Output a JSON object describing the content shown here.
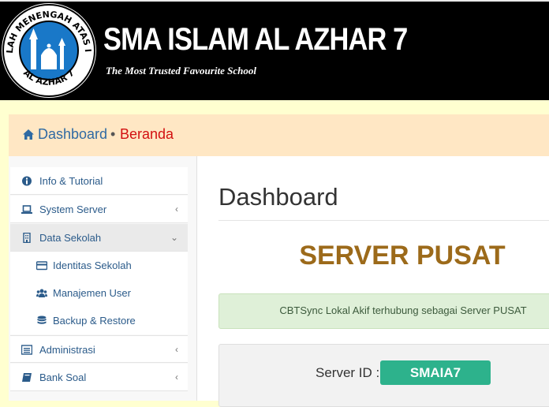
{
  "header": {
    "logo_ring_text": "SEKOLAH MENENGAH ATAS ISLAM",
    "logo_bottom_text": "AL AZHAR 7",
    "school_name": "SMA ISLAM AL AZHAR 7",
    "tagline": "The Most Trusted Favourite School"
  },
  "breadcrumb": {
    "current": "Dashboard",
    "separator": "•",
    "home": "Beranda"
  },
  "sidebar": {
    "items": [
      {
        "label": "Info & Tutorial",
        "icon": "info-icon"
      },
      {
        "label": "System Server",
        "icon": "laptop-icon",
        "caret": "‹"
      },
      {
        "label": "Data Sekolah",
        "icon": "building-icon",
        "caret": "⌄"
      },
      {
        "label": "Identitas Sekolah",
        "icon": "id-card-icon"
      },
      {
        "label": "Manajemen User",
        "icon": "users-icon"
      },
      {
        "label": "Backup & Restore",
        "icon": "database-icon"
      },
      {
        "label": "Administrasi",
        "icon": "list-icon",
        "caret": "‹"
      },
      {
        "label": "Bank Soal",
        "icon": "book-icon",
        "caret": "‹"
      }
    ]
  },
  "main": {
    "title": "Dashboard",
    "server_heading": "SERVER PUSAT",
    "alert_text": "CBTSync Lokal Akif terhubung sebagai Server PUSAT",
    "server_id_label": "Server ID :",
    "server_id_value": "SMAIA7"
  },
  "colors": {
    "page_bg": "#ffffd0",
    "breadcrumb_bg": "#ffe7c4",
    "heading_gold": "#9c6a1a",
    "badge_green": "#2db28c",
    "link_blue": "#2f6aa3",
    "home_red": "#d21010"
  }
}
